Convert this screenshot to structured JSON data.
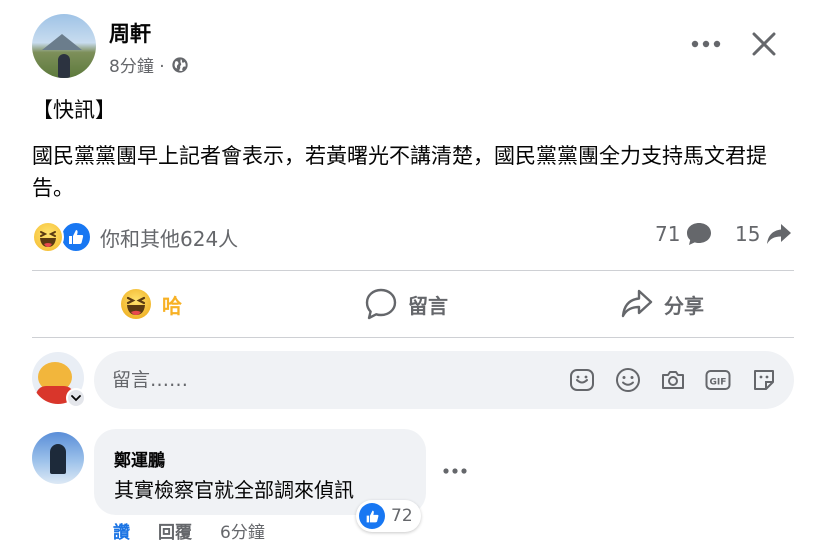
{
  "post": {
    "author": "周軒",
    "time": "8分鐘 ·",
    "tag_line": "【快訊】",
    "text": "國民黨黨團早上記者會表示，若黃曙光不講清楚，國民黨黨團全力支持馬文君提告。",
    "reactions": {
      "icons": [
        "haha-icon",
        "like-icon"
      ],
      "summary": "你和其他624人",
      "comments": "71",
      "shares": "15"
    },
    "actions": {
      "react_label": "哈",
      "comment_label": "留言",
      "share_label": "分享"
    }
  },
  "composer": {
    "placeholder": "留言……",
    "icons": [
      "sticker-icon",
      "emoji-icon",
      "camera-icon",
      "gif-icon",
      "avatar-sticker-icon"
    ]
  },
  "comment": {
    "author": "鄭運鵬",
    "text": "其實檢察官就全部調來偵訊",
    "likes": "72",
    "like_label": "讚",
    "reply_label": "回覆",
    "time": "6分鐘"
  },
  "colors": {
    "accent_blue": "#1877f2",
    "haha_yellow": "#f7b125",
    "secondary_text": "#65676b",
    "bubble_bg": "#f0f2f5"
  }
}
